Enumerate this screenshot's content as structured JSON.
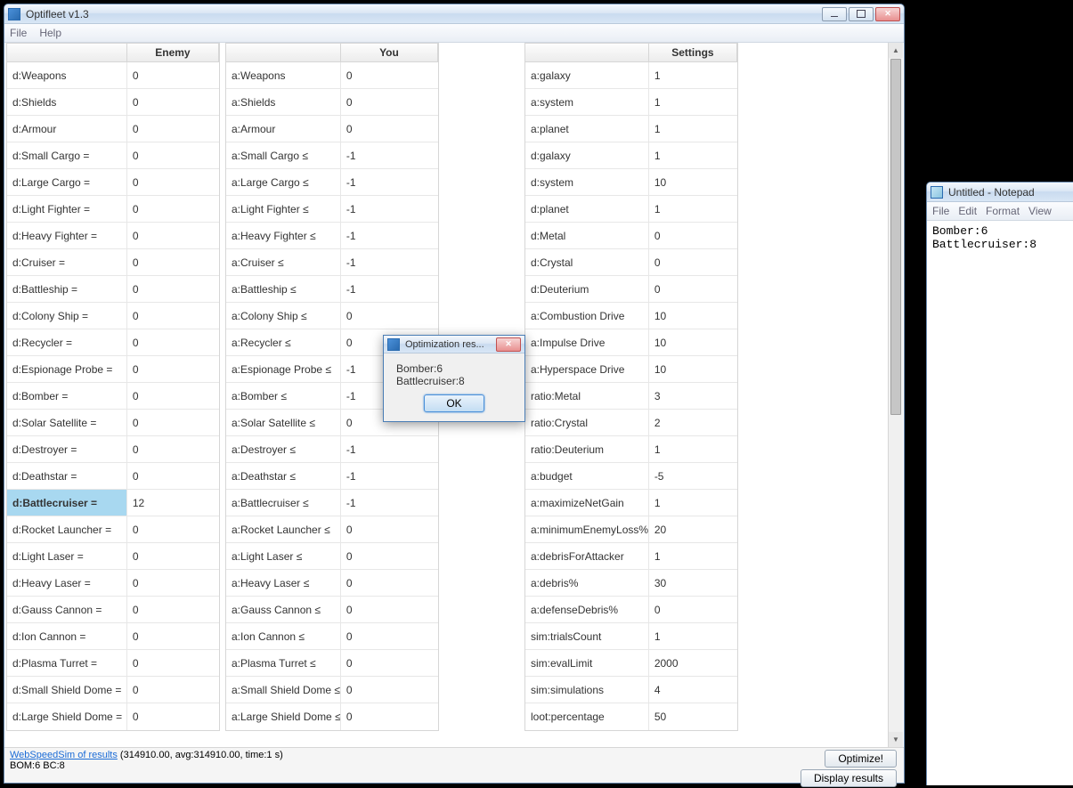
{
  "mainWindow": {
    "title": "Optifleet v1.3",
    "menus": [
      "File",
      "Help"
    ],
    "columns": {
      "enemyLabel": "",
      "enemyHeader": "Enemy",
      "youLabel": "",
      "youHeader": "You",
      "settingsLabel": "",
      "settingsHeader": "Settings"
    },
    "enemy": [
      {
        "k": "d:Weapons",
        "v": "0"
      },
      {
        "k": "d:Shields",
        "v": "0"
      },
      {
        "k": "d:Armour",
        "v": "0"
      },
      {
        "k": "d:Small Cargo =",
        "v": "0"
      },
      {
        "k": "d:Large Cargo =",
        "v": "0"
      },
      {
        "k": "d:Light Fighter =",
        "v": "0"
      },
      {
        "k": "d:Heavy Fighter =",
        "v": "0"
      },
      {
        "k": "d:Cruiser =",
        "v": "0"
      },
      {
        "k": "d:Battleship =",
        "v": "0"
      },
      {
        "k": "d:Colony Ship =",
        "v": "0"
      },
      {
        "k": "d:Recycler =",
        "v": "0"
      },
      {
        "k": "d:Espionage Probe =",
        "v": "0"
      },
      {
        "k": "d:Bomber =",
        "v": "0"
      },
      {
        "k": "d:Solar Satellite =",
        "v": "0"
      },
      {
        "k": "d:Destroyer =",
        "v": "0"
      },
      {
        "k": "d:Deathstar =",
        "v": "0"
      },
      {
        "k": "d:Battlecruiser =",
        "v": "12",
        "selected": true
      },
      {
        "k": "d:Rocket Launcher =",
        "v": "0"
      },
      {
        "k": "d:Light Laser =",
        "v": "0"
      },
      {
        "k": "d:Heavy Laser =",
        "v": "0"
      },
      {
        "k": "d:Gauss Cannon =",
        "v": "0"
      },
      {
        "k": "d:Ion Cannon =",
        "v": "0"
      },
      {
        "k": "d:Plasma Turret =",
        "v": "0"
      },
      {
        "k": "d:Small Shield Dome =",
        "v": "0"
      },
      {
        "k": "d:Large Shield Dome =",
        "v": "0"
      }
    ],
    "you": [
      {
        "k": "a:Weapons",
        "v": "0"
      },
      {
        "k": "a:Shields",
        "v": "0"
      },
      {
        "k": "a:Armour",
        "v": "0"
      },
      {
        "k": "a:Small Cargo ≤",
        "v": "-1"
      },
      {
        "k": "a:Large Cargo ≤",
        "v": "-1"
      },
      {
        "k": "a:Light Fighter ≤",
        "v": "-1"
      },
      {
        "k": "a:Heavy Fighter ≤",
        "v": "-1"
      },
      {
        "k": "a:Cruiser ≤",
        "v": "-1"
      },
      {
        "k": "a:Battleship ≤",
        "v": "-1"
      },
      {
        "k": "a:Colony Ship ≤",
        "v": "0"
      },
      {
        "k": "a:Recycler ≤",
        "v": "0"
      },
      {
        "k": "a:Espionage Probe ≤",
        "v": "-1"
      },
      {
        "k": "a:Bomber ≤",
        "v": "-1"
      },
      {
        "k": "a:Solar Satellite ≤",
        "v": "0"
      },
      {
        "k": "a:Destroyer ≤",
        "v": "-1"
      },
      {
        "k": "a:Deathstar ≤",
        "v": "-1"
      },
      {
        "k": "a:Battlecruiser ≤",
        "v": "-1"
      },
      {
        "k": "a:Rocket Launcher ≤",
        "v": "0"
      },
      {
        "k": "a:Light Laser ≤",
        "v": "0"
      },
      {
        "k": "a:Heavy Laser ≤",
        "v": "0"
      },
      {
        "k": "a:Gauss Cannon ≤",
        "v": "0"
      },
      {
        "k": "a:Ion Cannon ≤",
        "v": "0"
      },
      {
        "k": "a:Plasma Turret ≤",
        "v": "0"
      },
      {
        "k": "a:Small Shield Dome ≤",
        "v": "0"
      },
      {
        "k": "a:Large Shield Dome ≤",
        "v": "0"
      }
    ],
    "settings": [
      {
        "k": "a:galaxy",
        "v": "1"
      },
      {
        "k": "a:system",
        "v": "1"
      },
      {
        "k": "a:planet",
        "v": "1"
      },
      {
        "k": "d:galaxy",
        "v": "1"
      },
      {
        "k": "d:system",
        "v": "10"
      },
      {
        "k": "d:planet",
        "v": "1"
      },
      {
        "k": "d:Metal",
        "v": "0"
      },
      {
        "k": "d:Crystal",
        "v": "0"
      },
      {
        "k": "d:Deuterium",
        "v": "0"
      },
      {
        "k": "a:Combustion Drive",
        "v": "10"
      },
      {
        "k": "a:Impulse Drive",
        "v": "10"
      },
      {
        "k": "a:Hyperspace Drive",
        "v": "10"
      },
      {
        "k": "ratio:Metal",
        "v": "3"
      },
      {
        "k": "ratio:Crystal",
        "v": "2"
      },
      {
        "k": "ratio:Deuterium",
        "v": "1"
      },
      {
        "k": "a:budget",
        "v": "-5"
      },
      {
        "k": "a:maximizeNetGain",
        "v": "1"
      },
      {
        "k": "a:minimumEnemyLoss%",
        "v": "20"
      },
      {
        "k": "a:debrisForAttacker",
        "v": "1"
      },
      {
        "k": "a:debris%",
        "v": "30"
      },
      {
        "k": "a:defenseDebris%",
        "v": "0"
      },
      {
        "k": "sim:trialsCount",
        "v": "1"
      },
      {
        "k": "sim:evalLimit",
        "v": "2000"
      },
      {
        "k": "sim:simulations",
        "v": "4"
      },
      {
        "k": "loot:percentage",
        "v": "50"
      }
    ],
    "footer": {
      "link": "WebSpeedSim of results",
      "stats": "(314910.00, avg:314910.00, time:1 s)",
      "summary": "BOM:6 BC:8",
      "btn1": "Optimize!",
      "btn2": "Display results"
    }
  },
  "dialog": {
    "title": "Optimization res...",
    "lines": [
      "Bomber:6",
      "Battlecruiser:8"
    ],
    "ok": "OK"
  },
  "notepad": {
    "title": "Untitled - Notepad",
    "menus": [
      "File",
      "Edit",
      "Format",
      "View"
    ],
    "text": "Bomber:6\nBattlecruiser:8"
  }
}
